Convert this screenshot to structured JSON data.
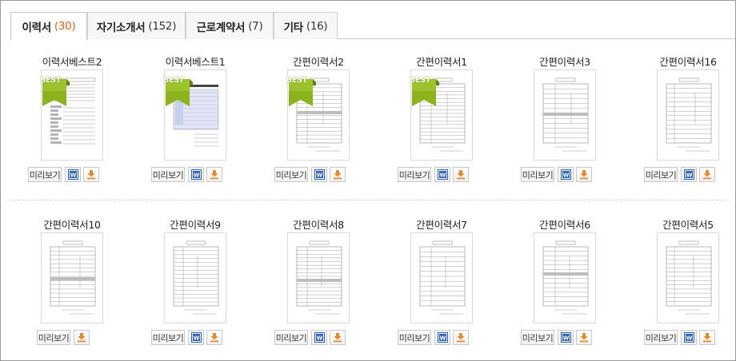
{
  "tabs": [
    {
      "label": "이력서",
      "count": "(30)",
      "active": true
    },
    {
      "label": "자기소개서",
      "count": "(152)",
      "active": false
    },
    {
      "label": "근로계약서",
      "count": "(7)",
      "active": false
    },
    {
      "label": "기타",
      "count": "(16)",
      "active": false
    }
  ],
  "badge_label": "BEST",
  "preview_label": "미리보기",
  "colors": {
    "accent_orange": "#e8631c",
    "ribbon_green": "#8cb31c",
    "word_blue": "#2b5fb8",
    "download_orange": "#e8892a"
  },
  "icons": {
    "word": "word-doc-icon",
    "download": "download-icon"
  },
  "rows": [
    [
      {
        "title": "이력서베스트2",
        "best": true,
        "word": true
      },
      {
        "title": "이력서베스트1",
        "best": true,
        "word": true
      },
      {
        "title": "간편이력서2",
        "best": true,
        "word": true
      },
      {
        "title": "간편이력서1",
        "best": true,
        "word": true
      },
      {
        "title": "간편이력서3",
        "best": false,
        "word": true
      },
      {
        "title": "간편이력서16",
        "best": false,
        "word": true
      }
    ],
    [
      {
        "title": "간편이력서10",
        "best": false,
        "word": false
      },
      {
        "title": "간편이력서9",
        "best": false,
        "word": true
      },
      {
        "title": "간편이력서8",
        "best": false,
        "word": true
      },
      {
        "title": "간편이력서7",
        "best": false,
        "word": true
      },
      {
        "title": "간편이력서6",
        "best": false,
        "word": true
      },
      {
        "title": "간편이력서5",
        "best": false,
        "word": true
      }
    ]
  ]
}
